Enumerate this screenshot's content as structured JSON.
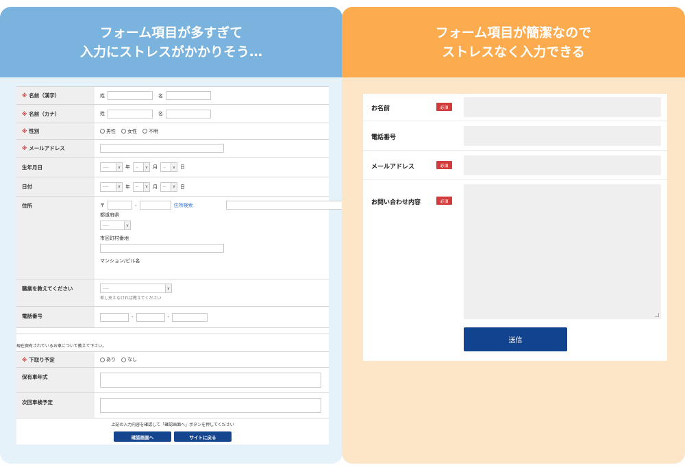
{
  "left_panel": {
    "heading_lines": [
      "フォーム項目が多すぎて",
      "入力にストレスがかかりそう…"
    ],
    "rows": {
      "name_kanji": {
        "req": "※",
        "label": "名前（漢字）",
        "sei": "姓",
        "mei": "名"
      },
      "name_kana": {
        "req": "※",
        "label": "名前（カナ）",
        "sei": "姓",
        "mei": "名"
      },
      "gender": {
        "req": "※",
        "label": "性別",
        "options": [
          "男性",
          "女性",
          "不明"
        ]
      },
      "email": {
        "req": "※",
        "label": "メールアドレス"
      },
      "birthday": {
        "label": "生年月日",
        "placeholder": "----",
        "dash": "--",
        "year": "年",
        "month": "月",
        "day": "日"
      },
      "date": {
        "label": "日付",
        "placeholder": "----",
        "dash": "--",
        "year": "年",
        "month": "月",
        "day": "日"
      },
      "address": {
        "label": "住所",
        "postal_mark": "〒",
        "hyphen": "-",
        "search_link": "住所検索",
        "prefecture": "都道府県",
        "pref_placeholder": "----",
        "city": "市区町村番地",
        "building": "マンション/ビル名"
      },
      "occupation": {
        "label": "職業を教えてください",
        "placeholder": "----",
        "hint": "差し支えなければ教えてください"
      },
      "phone": {
        "label": "電話番号",
        "hyphen": "-"
      },
      "section_note": "現在保有されているお車について教えて下さい。",
      "tradein": {
        "req": "※",
        "label": "下取り予定",
        "options": [
          "あり",
          "なし"
        ]
      },
      "car_year": {
        "label": "保有車年式"
      },
      "inspection": {
        "label": "次回車検予定"
      }
    },
    "footer_note": "上記の入力内容を確認して「確認画面へ」ボタンを押してください",
    "buttons": {
      "confirm": "確認画面へ",
      "back": "サイトに戻る"
    }
  },
  "right_panel": {
    "heading_lines": [
      "フォーム項目が簡潔なので",
      "ストレスなく入力できる"
    ],
    "fields": {
      "name": {
        "label": "お名前",
        "badge": "必須"
      },
      "phone": {
        "label": "電話番号"
      },
      "email": {
        "label": "メールアドレス",
        "badge": "必須"
      },
      "inquiry": {
        "label": "お問い合わせ内容",
        "badge": "必須"
      }
    },
    "submit": "送信"
  },
  "colors": {
    "left_header": "#7ab3dd",
    "right_header": "#fcac4e",
    "left_bg": "#e6f2fa",
    "right_bg": "#fde6c8",
    "required": "#d23b3b",
    "button": "#12438f"
  }
}
